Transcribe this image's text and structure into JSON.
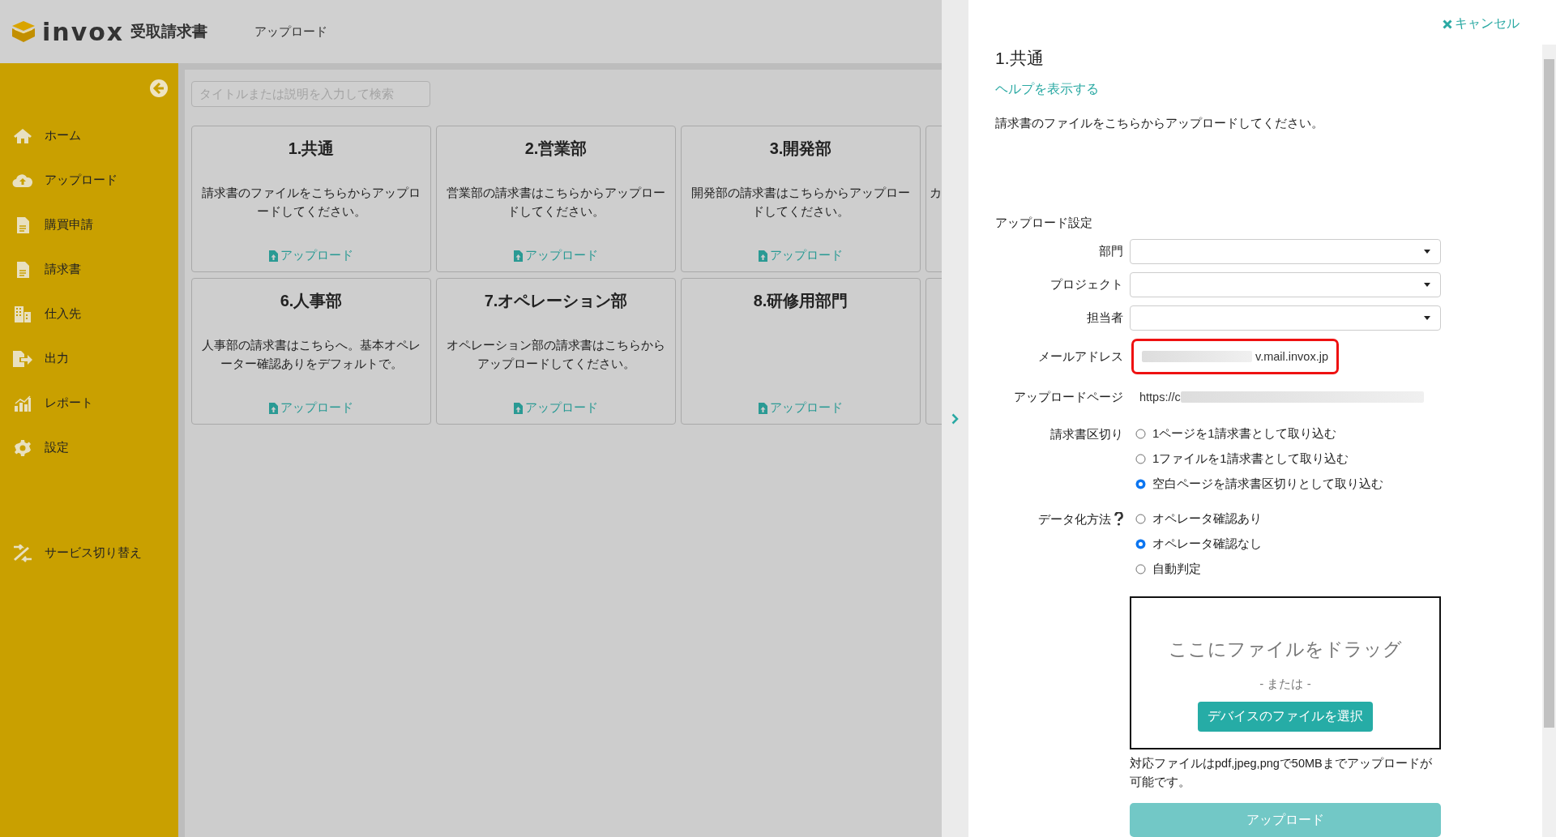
{
  "header": {
    "brand": "invox",
    "product": "受取請求書",
    "page_title": "アップロード"
  },
  "sidebar": {
    "items": [
      {
        "label": "ホーム"
      },
      {
        "label": "アップロード"
      },
      {
        "label": "購買申請"
      },
      {
        "label": "請求書"
      },
      {
        "label": "仕入先"
      },
      {
        "label": "出力"
      },
      {
        "label": "レポート"
      },
      {
        "label": "設定"
      }
    ],
    "footer_item": {
      "label": "サービス切り替え"
    }
  },
  "search": {
    "placeholder": "タイトルまたは説明を入力して検索"
  },
  "cards": [
    {
      "kind": "full",
      "title": "1.共通",
      "description": "請求書のファイルをこちらからアップロードしてください。",
      "link": "アップロード"
    },
    {
      "kind": "full",
      "title": "2.営業部",
      "description": "営業部の請求書はこちらからアップロードしてください。",
      "link": "アップロード"
    },
    {
      "kind": "full",
      "title": "3.開発部",
      "description": "開発部の請求書はこちらからアップロードしてください。",
      "link": "アップロード"
    },
    {
      "kind": "partial",
      "description": "カ"
    },
    {
      "kind": "full",
      "title": "6.人事部",
      "description": "人事部の請求書はこちらへ。基本オペレーター確認ありをデフォルトで。",
      "link": "アップロード"
    },
    {
      "kind": "full",
      "title": "7.オペレーション部",
      "description": "オペレーション部の請求書はこちらからアップロードしてください。",
      "link": "アップロード"
    },
    {
      "kind": "full",
      "title": "8.研修用部門",
      "link": "アップロード"
    },
    {
      "kind": "partial"
    }
  ],
  "panel": {
    "cancel": "キャンセル",
    "title": "1.共通",
    "help_link": "ヘルプを表示する",
    "description": "請求書のファイルをこちらからアップロードしてください。",
    "settings_heading": "アップロード設定",
    "selects": [
      {
        "label": "部門"
      },
      {
        "label": "プロジェクト"
      },
      {
        "label": "担当者"
      }
    ],
    "email": {
      "label": "メールアドレス",
      "value": "v.mail.invox.jp",
      "highlighted": true
    },
    "upload_page": {
      "label": "アップロードページ",
      "value": "https://c"
    },
    "radio_groups": [
      {
        "label": "請求書区切り",
        "help": false,
        "options": [
          {
            "label": "1ページを1請求書として取り込む",
            "selected": false
          },
          {
            "label": "1ファイルを1請求書として取り込む",
            "selected": false
          },
          {
            "label": "空白ページを請求書区切りとして取り込む",
            "selected": true
          }
        ]
      },
      {
        "label": "データ化方法",
        "help": true,
        "options": [
          {
            "label": "オペレータ確認あり",
            "selected": false
          },
          {
            "label": "オペレータ確認なし",
            "selected": true
          },
          {
            "label": "自動判定",
            "selected": false
          }
        ]
      }
    ],
    "dropzone": {
      "prompt": "ここにファイルをドラッグ",
      "or": "- または -",
      "button": "デバイスのファイルを選択"
    },
    "note": "対応ファイルはpdf,jpeg,pngで50MBまでアップロードが可能です。",
    "upload_button": {
      "label": "アップロード",
      "disabled": true
    }
  }
}
